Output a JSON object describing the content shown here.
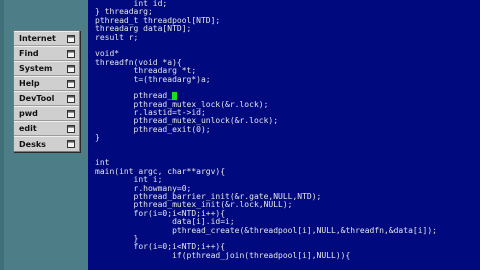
{
  "menu": {
    "items": [
      {
        "label": "Internet",
        "icon": "window-icon"
      },
      {
        "label": "Find",
        "icon": "window-icon"
      },
      {
        "label": "System",
        "icon": "window-icon"
      },
      {
        "label": "Help",
        "icon": "window-icon"
      },
      {
        "label": "DevTool",
        "icon": "window-icon"
      },
      {
        "label": "pwd",
        "icon": "window-icon"
      },
      {
        "label": "edit",
        "icon": "window-icon"
      },
      {
        "label": "Desks",
        "icon": "window-icon"
      }
    ]
  },
  "editor": {
    "background": "#000a7e",
    "cursor_color": "#18e018",
    "lines": [
      "        int id;",
      "} threadarg;",
      "pthread_t threadpool[NTD];",
      "threadarg data[NTD];",
      "result r;",
      "",
      "void*",
      "threadfn(void *a){",
      "        threadarg *t;",
      "        t=(threadarg*)a;",
      "",
      "        pthread_",
      "        pthread_mutex_lock(&r.lock);",
      "        r.lastid=t->id;",
      "        pthread_mutex_unlock(&r.lock);",
      "        pthread_exit(0);",
      "}",
      "",
      "",
      "int",
      "main(int argc, char**argv){",
      "        int i;",
      "        r.howmany=0;",
      "        pthread_barrier_init(&r.gate,NULL,NTD);",
      "        pthread_mutex_init(&r.lock,NULL);",
      "        for(i=0;i<NTD;i++){",
      "                data[i].id=i;",
      "                pthread_create(&threadpool[i],NULL,&threadfn,&data[i]);",
      "        }",
      "        for(i=0;i<NTD;i++){",
      "                if(pthread_join(threadpool[i],NULL)){"
    ],
    "cursor_line": 11
  }
}
